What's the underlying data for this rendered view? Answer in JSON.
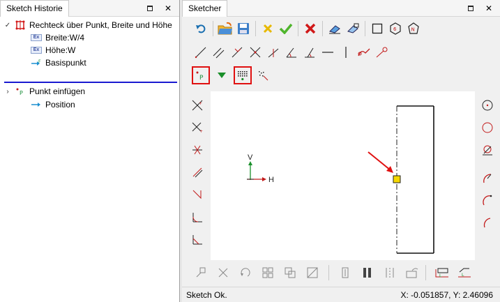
{
  "left_panel": {
    "title": "Sketch Historie",
    "tree": [
      {
        "label": "Rechteck über Punkt, Breite und Höhe",
        "chevron": "✓",
        "icon": "rectangle-icon"
      },
      {
        "label": "Breite:W/4",
        "icon": "expression-icon"
      },
      {
        "label": "Höhe:W",
        "icon": "expression-icon"
      },
      {
        "label": "Basispunkt",
        "icon": "point-arrow-icon"
      },
      {
        "label": "Punkt einfügen",
        "chevron": "›",
        "icon": "point-icon"
      },
      {
        "label": "Position",
        "icon": "arrow-icon"
      }
    ]
  },
  "right_panel": {
    "title": "Sketcher",
    "status": "Sketch Ok.",
    "coords": "X: -0.051857, Y: 2.46096"
  },
  "canvas": {
    "axis_v": "V",
    "axis_h": "H"
  },
  "colors": {
    "highlight": "#e01010",
    "selected_point": "#f5d800",
    "accent_line": "#1a1ad0"
  }
}
